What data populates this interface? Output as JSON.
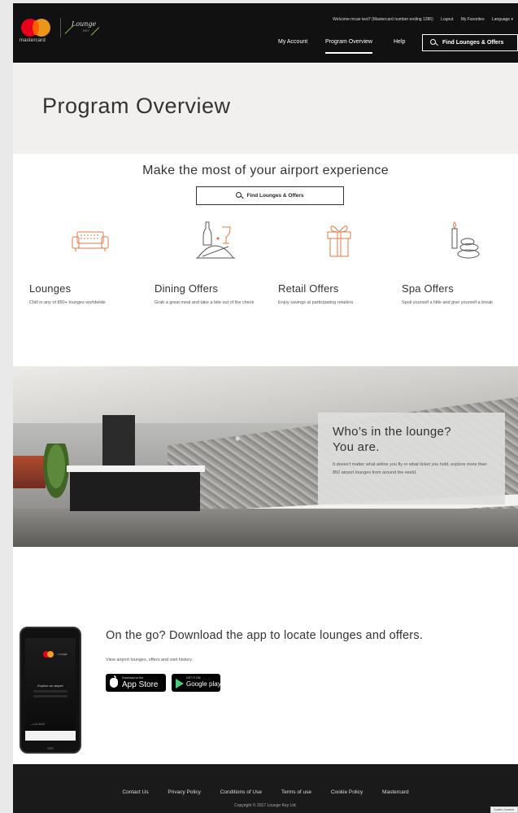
{
  "header": {
    "brand_word": "mastercard",
    "lk_logo_text": "Lounge",
    "lk_logo_sub": "KEY",
    "utility": {
      "welcome": "Welcome mcae test7  (Mastercard number ending 1286)",
      "logout": "Logout",
      "favorites": "My Favorites",
      "language": "Language ▾"
    },
    "nav": {
      "my_account": "My Account",
      "program_overview": "Program Overview",
      "help": "Help",
      "find": "Find Lounges & Offers"
    }
  },
  "page_title": "Program Overview",
  "benefits": {
    "tagline": "Make the most of your airport experience",
    "find_button": "Find Lounges & Offers",
    "items": [
      {
        "icon": "sofa-icon",
        "title": "Lounges",
        "desc": "Chill in any of 850+ lounges worldwide"
      },
      {
        "icon": "dining-icon",
        "title": "Dining Offers",
        "desc": "Grab a great meal and take a bite out of the check"
      },
      {
        "icon": "gift-icon",
        "title": "Retail Offers",
        "desc": "Enjoy savings at participating retailers"
      },
      {
        "icon": "spa-stones-icon",
        "title": "Spa Offers",
        "desc": "Spoil yourself a little and give yourself a break"
      }
    ]
  },
  "lounge_promo": {
    "heading_line1": "Who’s in the lounge?",
    "heading_line2": "You are.",
    "body": "It doesn't matter what airline you fly or what ticket you hold, explore more than 850 airport lounges from around the world."
  },
  "app": {
    "title": "On the go? Download the app to locate lounges and offers.",
    "desc": "View airport lounges, offers and visit history.",
    "app_store_small": "Download on the",
    "app_store_big": "App Store",
    "google_small": "GET IT ON",
    "google_big": "Google play",
    "phone_explore": "Explore an airport",
    "phone_brand": "—LOUNGE"
  },
  "footer": {
    "links": [
      "Contact Us",
      "Privacy Policy",
      "Conditions of Use",
      "Terms of use",
      "Cookie Policy",
      "Mastercard"
    ],
    "copyright": "Copyright © 2017 Lounge Key Ltd."
  },
  "cookie_tab": "Cookie Consent",
  "colors": {
    "header_bg": "#111111",
    "title_band": "#f1f0ee",
    "accent_orange": "#e0784a",
    "mc_red": "#eb001b",
    "mc_yellow": "#f79e1b"
  }
}
